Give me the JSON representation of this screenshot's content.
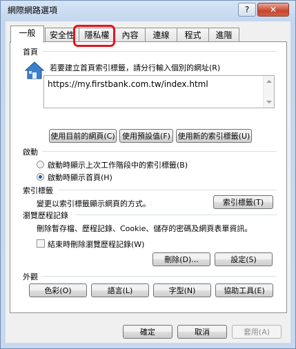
{
  "window": {
    "title": "網際網路選項",
    "help_label": "?",
    "close_label": "✕"
  },
  "tabs": [
    "一般",
    "安全性",
    "隱私權",
    "內容",
    "連線",
    "程式",
    "進階"
  ],
  "highlight_color": "#e3141c",
  "homepage": {
    "group_label": "首頁",
    "instruction": "若要建立首頁索引標籤，請分行輸入個別的網址(R)",
    "url_value": "https://my.firstbank.com.tw/index.html",
    "use_current_label": "使用目前的網頁(C)",
    "use_default_label": "使用預設值(F)",
    "use_new_tab_label": "使用新的索引標籤(U)"
  },
  "startup": {
    "group_label": "啟動",
    "option_last_session": "啟動時顯示上次工作階段中的索引標籤(B)",
    "option_home": "啟動時顯示首頁(H)",
    "selected": "option_home"
  },
  "tabs_section": {
    "group_label": "索引標籤",
    "description": "變更以索引標籤顯示網頁的方式。",
    "button_label": "索引標籤(T)"
  },
  "history": {
    "group_label": "瀏覽歷程記錄",
    "description": "刪除暫存檔、歷程記錄、Cookie、儲存的密碼及網頁表單資訊。",
    "delete_on_exit_label": "結束時刪除瀏覽歷程記錄(W)",
    "delete_on_exit_checked": false,
    "delete_button": "刪除(D)...",
    "settings_button": "設定(S)"
  },
  "appearance": {
    "group_label": "外觀",
    "colors_button": "色彩(O)",
    "languages_button": "語言(L)",
    "fonts_button": "字型(N)",
    "accessibility_button": "協助工具(E)"
  },
  "footer": {
    "ok": "確定",
    "cancel": "取消",
    "apply": "套用(A)"
  }
}
